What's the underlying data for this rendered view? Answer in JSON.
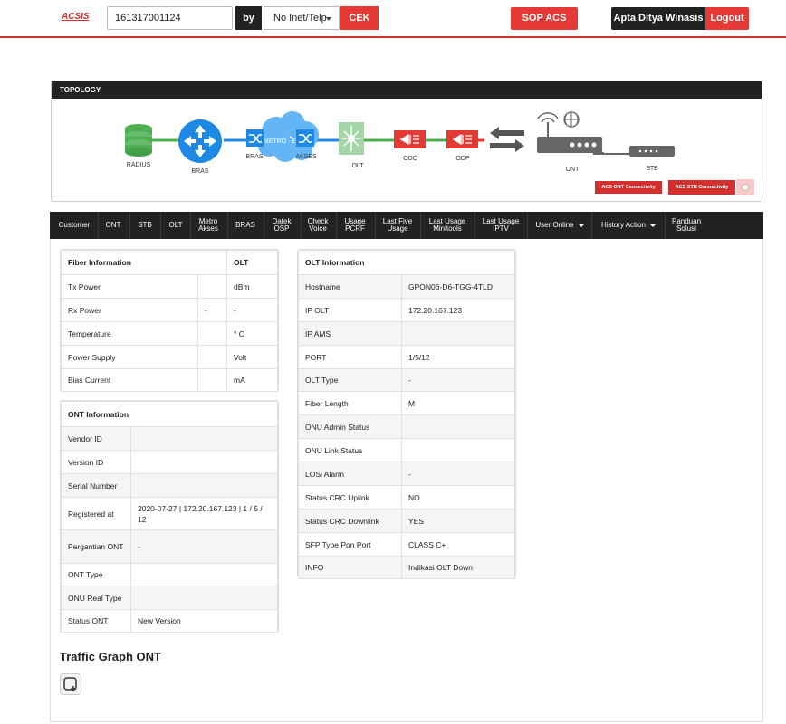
{
  "header": {
    "logo": "ACSIS",
    "search_value": "161317001124",
    "by_label": "by",
    "search_type": "No Inet/Telp",
    "cek_label": "CEK",
    "sop_label": "SOP ACS",
    "user_name": "Apta Ditya Winasis",
    "logout_label": "Logout"
  },
  "topology": {
    "title": "TOPOLOGY",
    "nodes": {
      "radius": "RADIUS",
      "bras": "BRAS",
      "metro_bras": "BRAS",
      "metro_label": "METRO - E",
      "akses": "AKSES",
      "olt": "OLT",
      "odc": "ODC",
      "odp": "ODP",
      "ont": "ONT",
      "stb": "STB"
    },
    "acs_ont_label": "ACS ONT Connectivity",
    "acs_stb_label": "ACS STB Connectivity",
    "colors": {
      "radius": "#4caf50",
      "bras": "#1e88e5",
      "olt": "#a5d6a7",
      "odc": "#e53935",
      "ont": "#666666"
    }
  },
  "nav": {
    "items": [
      {
        "label": "Customer"
      },
      {
        "label": "ONT"
      },
      {
        "label": "STB"
      },
      {
        "label": "OLT"
      },
      {
        "label": "Metro\nAkses"
      },
      {
        "label": "BRAS"
      },
      {
        "label": "Datek\nOSP"
      },
      {
        "label": "Check\nVoice"
      },
      {
        "label": "Usage\nPCRF"
      },
      {
        "label": "Last Five\nUsage"
      },
      {
        "label": "Last Usage\nMinitools"
      },
      {
        "label": "Last Usage\nIPTV"
      },
      {
        "label": "User Online"
      },
      {
        "label": "History Action"
      },
      {
        "label": "Panduan\nSolusi"
      }
    ]
  },
  "fiber": {
    "header_left": "Fiber Information",
    "header_right": "OLT",
    "rows": [
      {
        "label": "Tx Power",
        "a": "",
        "b": "dBm"
      },
      {
        "label": "Rx Power",
        "a": "-",
        "b": "-"
      },
      {
        "label": "Temperature",
        "a": "",
        "b": "° C"
      },
      {
        "label": "Power Supply",
        "a": "",
        "b": "Volt"
      },
      {
        "label": "Bias Current",
        "a": "",
        "b": "mA"
      }
    ]
  },
  "ont_info": {
    "header": "ONT Information",
    "rows": [
      {
        "label": "Vendor ID",
        "value": ""
      },
      {
        "label": "Version ID",
        "value": ""
      },
      {
        "label": "Serial Number",
        "value": ""
      },
      {
        "label": "Registered at",
        "value": "2020-07-27 | 172.20.167.123 | 1 / 5 / 12"
      },
      {
        "label": "Pergantian ONT",
        "value": "-"
      },
      {
        "label": "ONT Type",
        "value": ""
      },
      {
        "label": "ONU Real Type",
        "value": ""
      },
      {
        "label": "Status ONT",
        "value": "New Version"
      }
    ]
  },
  "olt_info": {
    "header": "OLT Information",
    "rows": [
      {
        "label": "Hostname",
        "value": "GPON06-D6-TGG-4TLD"
      },
      {
        "label": "IP OLT",
        "value": "172.20.167.123"
      },
      {
        "label": "IP AMS",
        "value": ""
      },
      {
        "label": "PORT",
        "value": "1/5/12"
      },
      {
        "label": "OLT Type",
        "value": "-"
      },
      {
        "label": "Fiber Length",
        "value": "M"
      },
      {
        "label": "ONU Admin Status",
        "value": ""
      },
      {
        "label": "ONU Link Status",
        "value": ""
      },
      {
        "label": "LOSi Alarm",
        "value": "-"
      },
      {
        "label": "Status CRC Uplink",
        "value": "NO"
      },
      {
        "label": "Status CRC Downlink",
        "value": "YES"
      },
      {
        "label": "SFP Type Pon Port",
        "value": "CLASS C+"
      },
      {
        "label": "INFO",
        "value": "Indikasi OLT Down"
      }
    ]
  },
  "traffic": {
    "title": "Traffic Graph ONT"
  }
}
